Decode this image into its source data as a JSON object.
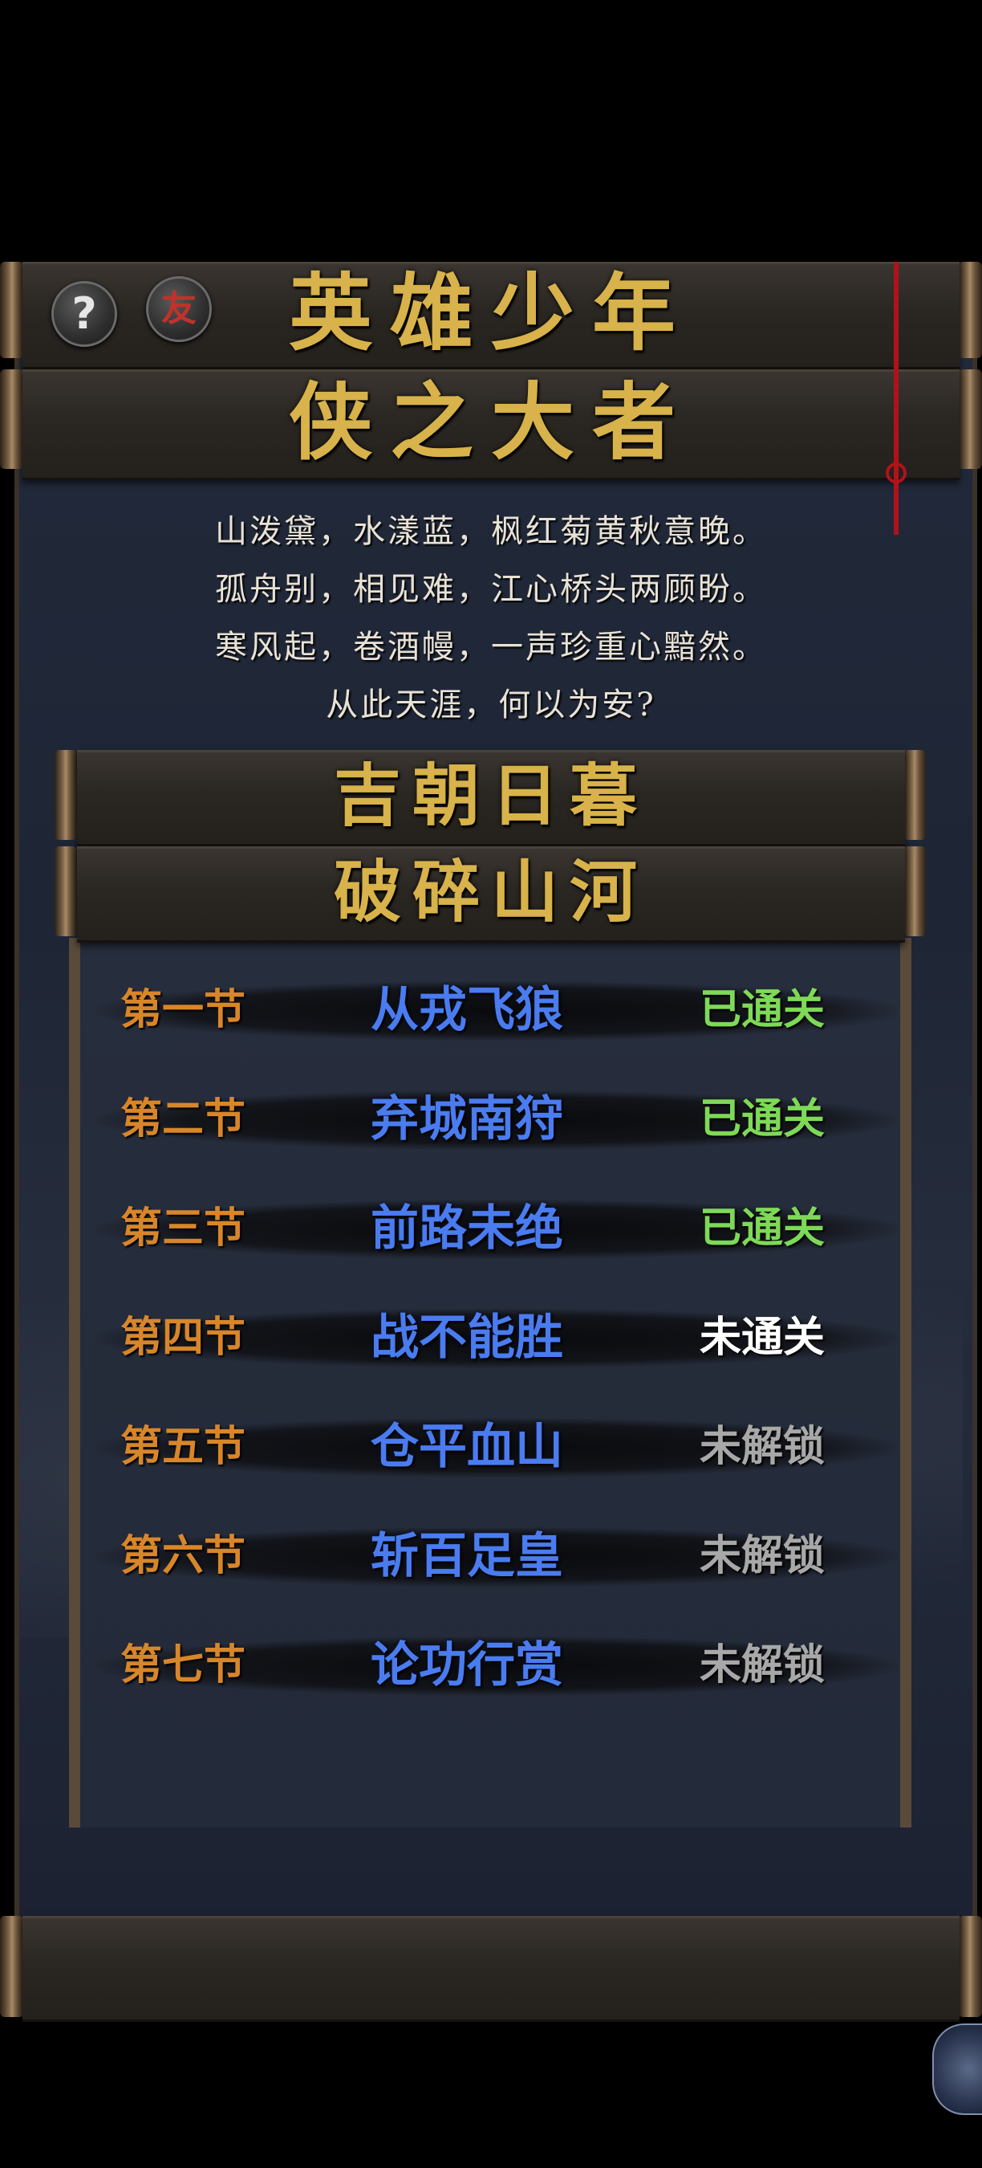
{
  "header": {
    "help_icon_glyph": "?",
    "friend_icon_glyph": "友",
    "title_line1": "英雄少年",
    "title_line2": "侠之大者"
  },
  "poem": [
    "山泼黛，水漾蓝，枫红菊黄秋意晚。",
    "孤舟别，相见难，江心桥头两顾盼。",
    "寒风起，卷酒幔，一声珍重心黯然。",
    "从此天涯，何以为安?"
  ],
  "chapter": {
    "title_line1": "吉朝日暮",
    "title_line2": "破碎山河"
  },
  "sections": [
    {
      "section": "第一节",
      "name": "从戎飞狼",
      "status": "已通关",
      "status_color": "#7ed957"
    },
    {
      "section": "第二节",
      "name": "弃城南狩",
      "status": "已通关",
      "status_color": "#7ed957"
    },
    {
      "section": "第三节",
      "name": "前路未绝",
      "status": "已通关",
      "status_color": "#7ed957"
    },
    {
      "section": "第四节",
      "name": "战不能胜",
      "status": "未通关",
      "status_color": "#ffffff"
    },
    {
      "section": "第五节",
      "name": "仓平血山",
      "status": "未解锁",
      "status_color": "#a8a8a8"
    },
    {
      "section": "第六节",
      "name": "斩百足皇",
      "status": "未解锁",
      "status_color": "#a8a8a8"
    },
    {
      "section": "第七节",
      "name": "论功行赏",
      "status": "未解锁",
      "status_color": "#a8a8a8"
    }
  ],
  "colors": {
    "title_gold": "#d8b24a",
    "section_orange": "#d8862a",
    "name_blue": "#4a7cf0",
    "tassel_red": "#b0121a"
  }
}
